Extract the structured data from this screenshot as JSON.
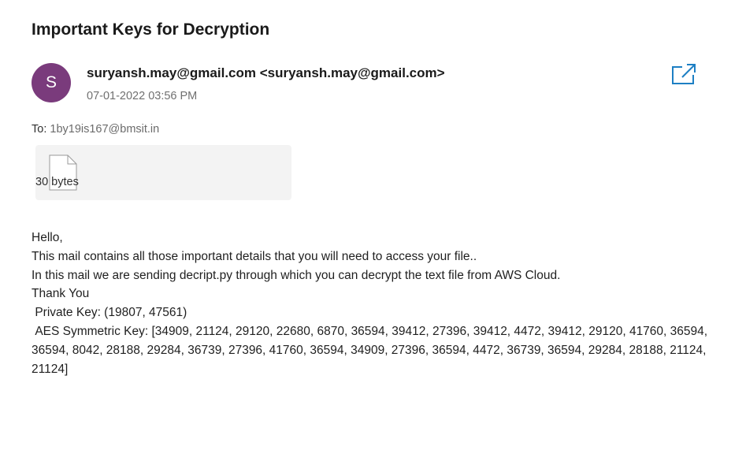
{
  "email": {
    "subject": "Important Keys for Decryption",
    "avatar_initial": "S",
    "sender": "suryansh.may@gmail.com <suryansh.may@gmail.com>",
    "date": "07-01-2022 03:56 PM",
    "to_label": "To: ",
    "to_value": "1by19is167@bmsit.in",
    "attachment_size": "30 bytes",
    "body_lines": [
      "Hello,",
      "This mail contains all those important details that you will need to access your file..",
      "In this mail we are sending decript.py through which you can decrypt the text file from AWS Cloud.",
      "Thank You",
      " Private Key: (19807, 47561)",
      " AES Symmetric Key: [34909, 21124, 29120, 22680, 6870, 36594, 39412, 27396, 39412, 4472, 39412, 29120, 41760, 36594, 36594, 8042, 28188, 29284, 36739, 27396, 41760, 36594, 34909, 27396, 36594, 4472, 36739, 36594, 29284, 28188, 21124, 21124]"
    ]
  },
  "icons": {
    "popout": "open-in-new-window-icon",
    "attachment": "file-icon"
  },
  "colors": {
    "avatar_bg": "#7a3b7c",
    "popout_icon": "#1d7fc4",
    "attachment_bg": "#f3f3f3"
  }
}
